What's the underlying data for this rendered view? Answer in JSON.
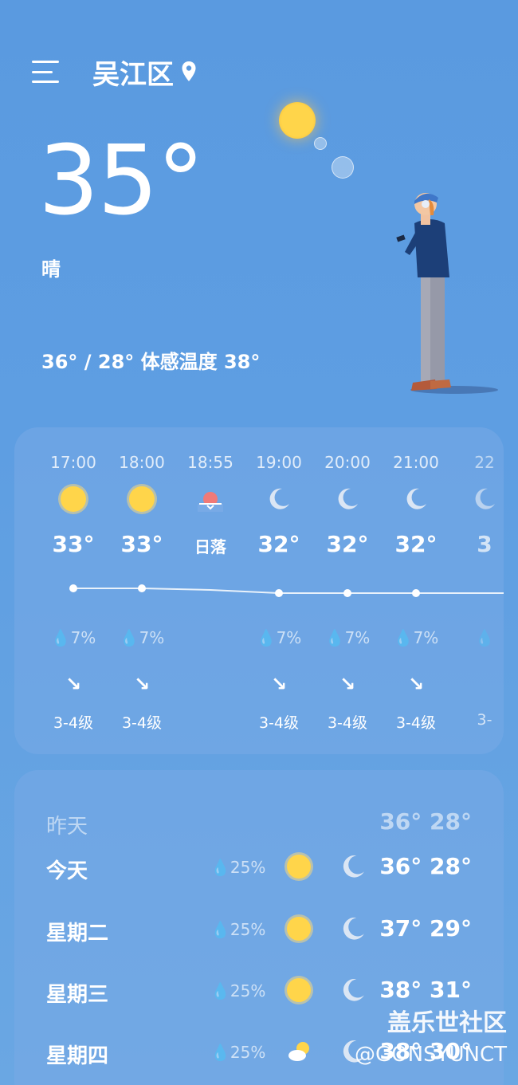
{
  "header": {
    "location": "吴江区"
  },
  "current": {
    "temperature": "35°",
    "condition": "晴",
    "range_text": "36° / 28° 体感温度 38°"
  },
  "hourly": [
    {
      "time": "17:00",
      "icon": "sun-icon",
      "temp": "33°",
      "rain": "7%",
      "arrow": "↘",
      "wind": "3-4级"
    },
    {
      "time": "18:00",
      "icon": "sun-icon",
      "temp": "33°",
      "rain": "7%",
      "arrow": "↘",
      "wind": "3-4级"
    },
    {
      "time": "18:55",
      "icon": "sunset-icon",
      "temp": "日落",
      "rain": "",
      "arrow": "",
      "wind": ""
    },
    {
      "time": "19:00",
      "icon": "moon-icon",
      "temp": "32°",
      "rain": "7%",
      "arrow": "↘",
      "wind": "3-4级"
    },
    {
      "time": "20:00",
      "icon": "moon-icon",
      "temp": "32°",
      "rain": "7%",
      "arrow": "↘",
      "wind": "3-4级"
    },
    {
      "time": "21:00",
      "icon": "moon-icon",
      "temp": "32°",
      "rain": "7%",
      "arrow": "↘",
      "wind": "3-4级"
    },
    {
      "time": "22",
      "icon": "moon-icon",
      "temp": "3",
      "rain": "",
      "arrow": "",
      "wind": "3-"
    }
  ],
  "daily": [
    {
      "day": "昨天",
      "rain": "",
      "temps": "36° 28°",
      "muted": true
    },
    {
      "day": "今天",
      "rain": "25%",
      "temps": "36° 28°",
      "day_icon": "sun-icon",
      "night_icon": "moon-icon"
    },
    {
      "day": "星期二",
      "rain": "25%",
      "temps": "37° 29°",
      "day_icon": "sun-icon",
      "night_icon": "moon-icon"
    },
    {
      "day": "星期三",
      "rain": "25%",
      "temps": "38° 31°",
      "day_icon": "sun-icon",
      "night_icon": "moon-icon"
    },
    {
      "day": "星期四",
      "rain": "25%",
      "temps": "38° 30°",
      "day_icon": "partly-cloudy-icon",
      "night_icon": "moon-icon"
    }
  ],
  "watermark": {
    "line1": "盖乐世社区",
    "line2": "@GONSYUNCT"
  },
  "colors": {
    "background": "#5a9ae0",
    "sun": "#ffd54a",
    "sunset": "#f07a78"
  }
}
